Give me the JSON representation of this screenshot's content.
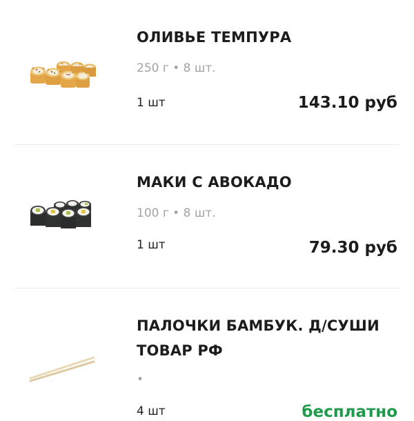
{
  "colors": {
    "text": "#1c1c1c",
    "muted": "#a3a3a3",
    "accent_free": "#1f9a4a",
    "divider": "#ebebeb"
  },
  "items": [
    {
      "image": "tempura-roll-image",
      "title": "ОЛИВЬЕ ТЕМПУРА",
      "meta": "250 г • 8 шт.",
      "qty": "1 шт",
      "price": "143.10 руб"
    },
    {
      "image": "avocado-maki-image",
      "title": "МАКИ С АВОКАДО",
      "meta": "100 г • 8 шт.",
      "qty": "1 шт",
      "price": "79.30 руб"
    },
    {
      "image": "bamboo-chopsticks-image",
      "title_line1": "ПАЛОЧКИ БАМБУК. Д/СУШИ",
      "title_line2": "ТОВАР РФ",
      "meta": "•",
      "qty": "4 шт",
      "price": "бесплатно"
    }
  ]
}
